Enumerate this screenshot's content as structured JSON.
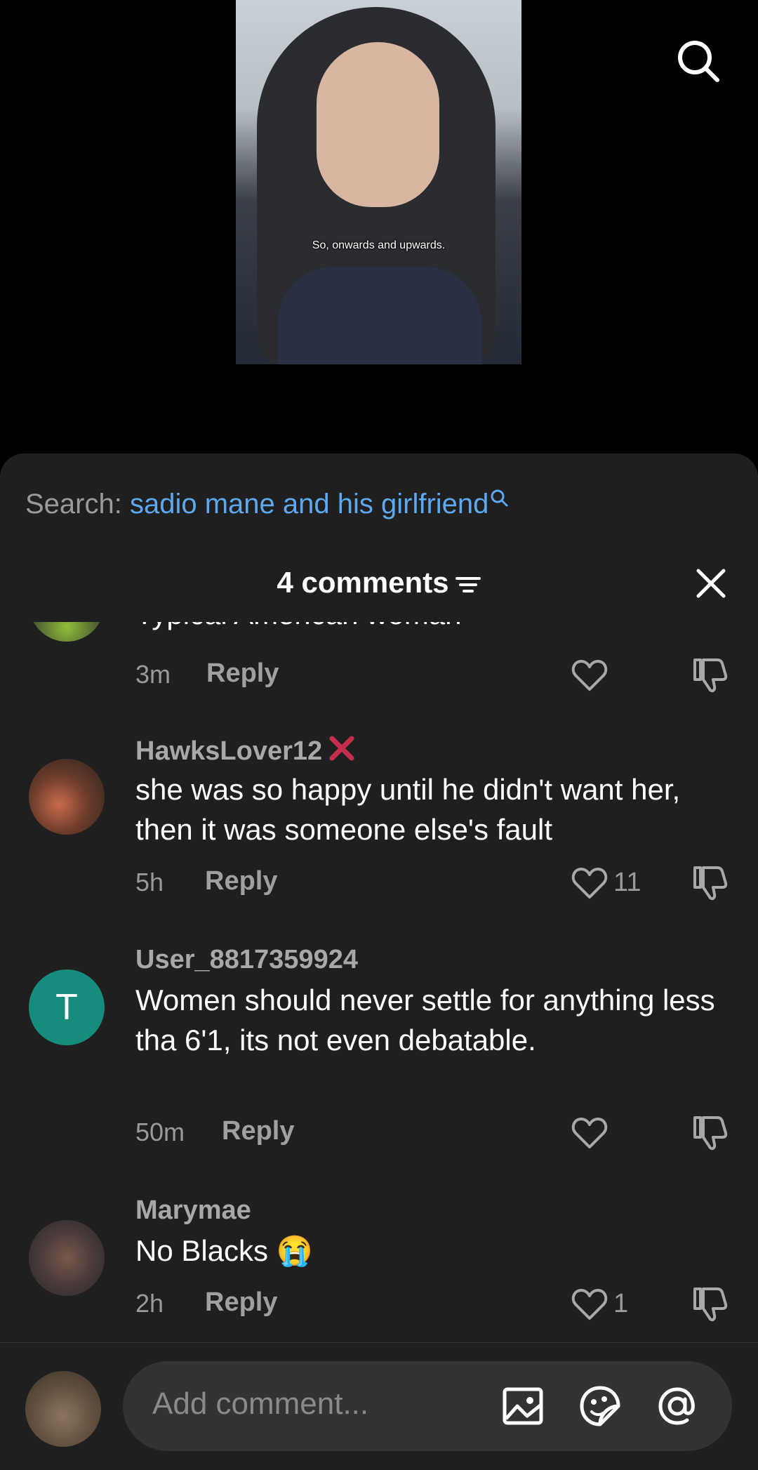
{
  "video": {
    "caption": "So, onwards and upwards."
  },
  "search": {
    "prefix": "Search:",
    "term": "sadio mane and his girlfriend"
  },
  "comments_header": {
    "title": "4 comments"
  },
  "comments": [
    {
      "text": "Typical American woman",
      "time": "3m",
      "reply": "Reply",
      "likes": ""
    },
    {
      "username": "HawksLover12",
      "text": "she was so happy until he didn't want her, then it was someone else's fault",
      "time": "5h",
      "reply": "Reply",
      "likes": "11"
    },
    {
      "username": "User_8817359924",
      "avatar_letter": "T",
      "text": "Women should never settle for anything less tha 6'1, its not even debatable.",
      "time": "50m",
      "reply": "Reply",
      "likes": ""
    },
    {
      "username": "Marymae",
      "text": "No Blacks 😭",
      "time": "2h",
      "reply": "Reply",
      "likes": "1"
    }
  ],
  "composer": {
    "placeholder": "Add comment..."
  },
  "colors": {
    "sheet_bg": "#1f1f1f",
    "link_blue": "#5ea8ef",
    "avatar_teal": "#168c7c",
    "badge_red": "#c42f4e"
  }
}
